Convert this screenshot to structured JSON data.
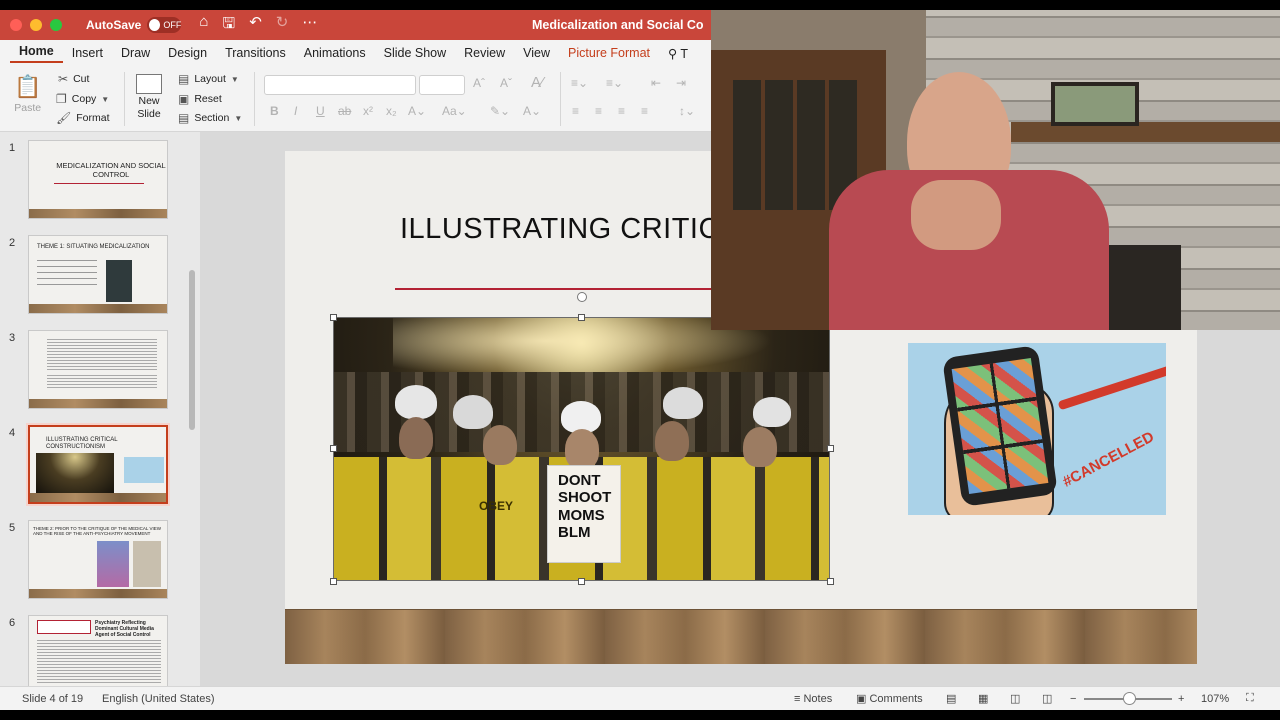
{
  "window": {
    "autosave_label": "AutoSave",
    "autosave_state": "OFF",
    "doc_title": "Medicalization and Social Co"
  },
  "tabs": [
    {
      "label": "Home"
    },
    {
      "label": "Insert"
    },
    {
      "label": "Draw"
    },
    {
      "label": "Design"
    },
    {
      "label": "Transitions"
    },
    {
      "label": "Animations"
    },
    {
      "label": "Slide Show"
    },
    {
      "label": "Review"
    },
    {
      "label": "View"
    },
    {
      "label": "Picture Format"
    },
    {
      "label": "T"
    }
  ],
  "ribbon": {
    "paste": "Paste",
    "cut": "Cut",
    "copy": "Copy",
    "format": "Format",
    "new_slide": "New",
    "new_slide_2": "Slide",
    "layout": "Layout",
    "reset": "Reset",
    "section": "Section"
  },
  "thumbnails": [
    {
      "num": "1",
      "title": "MEDICALIZATION AND SOCIAL CONTROL"
    },
    {
      "num": "2",
      "title": "THEME 1: SITUATING MEDICALIZATION"
    },
    {
      "num": "3",
      "title": ""
    },
    {
      "num": "4",
      "title": "ILLUSTRATING CRITICAL CONSTRUCTIONISM"
    },
    {
      "num": "5",
      "title": "THEME 2: PRIOR TO THE CRITIQUE OF THE MEDICAL VIEW AND THE RISE OF THE ANTI-PSYCHIATRY MOVEMENT"
    },
    {
      "num": "6",
      "title": "Psychiatry Reflecting Dominant Cultural Media Agent of Social Control"
    }
  ],
  "slide": {
    "title": "ILLUSTRATING CRITICA",
    "sign_text": "DONT SHOOT MOMS BLM",
    "cartoon_text": "#CANCELLED",
    "hoodie_text": "OBEY"
  },
  "status": {
    "slide_of": "Slide 4 of 19",
    "language": "English (United States)",
    "notes": "Notes",
    "comments": "Comments",
    "zoom": "107%"
  },
  "colors": {
    "titlebar": "#c9463a",
    "accent": "#c43e1c",
    "rule": "#b32234"
  }
}
